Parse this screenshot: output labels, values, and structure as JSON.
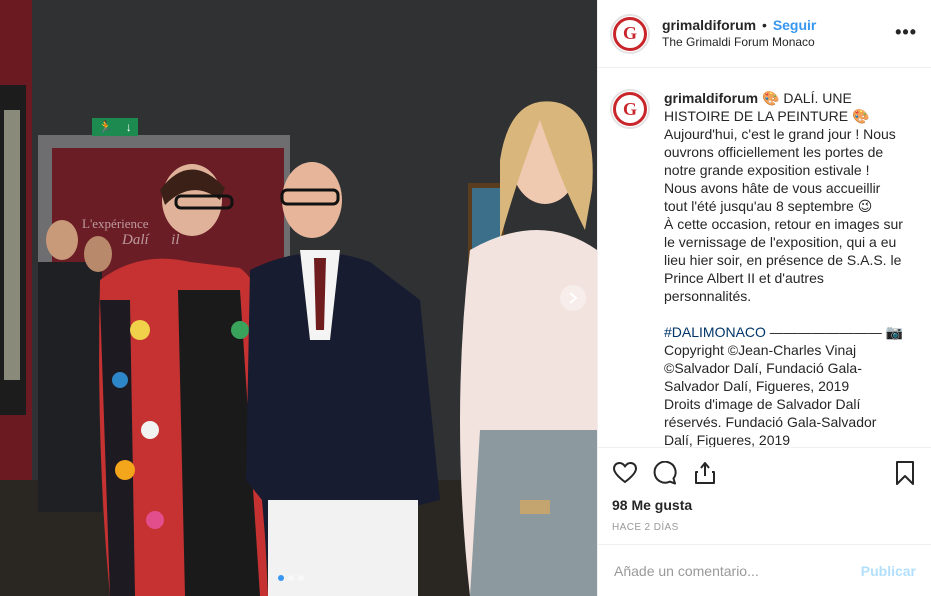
{
  "post": {
    "username": "grimaldiforum",
    "separator": "•",
    "follow_label": "Seguir",
    "location": "The Grimaldi Forum Monaco",
    "more_label": "•••",
    "avatar_letter": "G",
    "photo_wall_text_1": "L'expérience",
    "photo_wall_text_2": "Dalí",
    "photo_wall_text_3": "il",
    "caption_username": "grimaldiforum",
    "caption_body": " 🎨 DALÍ. UNE HISTOIRE DE LA PEINTURE 🎨\nAujourd'hui, c'est le grand jour ! Nous ouvrons officiellement les portes de notre grande exposition estivale ! Nous avons hâte de vous accueillir tout l'été jusqu'au 8 septembre 😉\nÀ cette occasion, retour en images sur le vernissage de l'exposition, qui a eu lieu hier soir, en présence de S.A.S. le Prince Albert II et d'autres personnalités.\n\n",
    "hashtag": "#DALIMONACO",
    "caption_tail": " ———————— 📷 Copyright ©Jean-Charles Vinaj ©Salvador Dalí, Fundació Gala-Salvador Dalí, Figueres, 2019\nDroits d'image de Salvador Dalí réservés. Fundació Gala-Salvador Dalí, Figueres, 2019",
    "likes": "98 Me gusta",
    "time_ago": "Hace 2 días",
    "comment_placeholder": "Añade un comentario...",
    "publish_label": "Publicar",
    "carousel": {
      "count": 3,
      "active": 1
    }
  },
  "icons": {
    "like": "heart-icon",
    "comment": "comment-bubble-icon",
    "share": "share-icon",
    "save": "bookmark-icon",
    "next": "chevron-right-icon",
    "more": "more-options-icon"
  },
  "colors": {
    "accent": "#3897f0",
    "brand": "#c8262b",
    "publish_disabled": "#b2dffc"
  }
}
